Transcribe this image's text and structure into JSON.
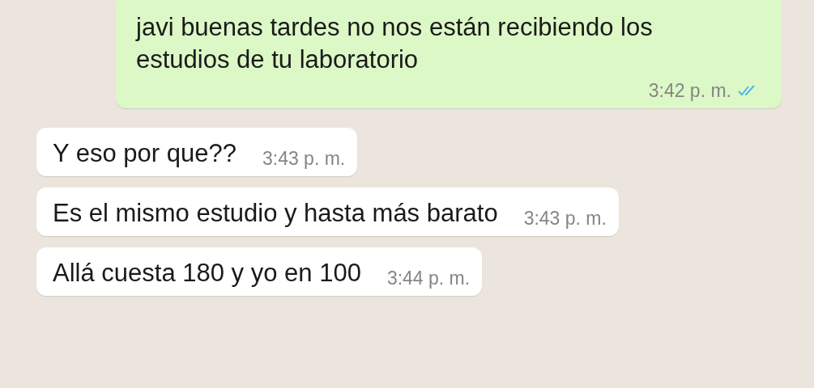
{
  "messages": [
    {
      "kind": "outgoing",
      "text": "javi buenas tardes no nos están recibiendo los estudios de tu laboratorio",
      "time": "3:42 p. m.",
      "read": true
    },
    {
      "kind": "incoming",
      "text": "Y eso por que??",
      "time": "3:43 p. m."
    },
    {
      "kind": "incoming",
      "text": "Es el mismo estudio y hasta más barato",
      "time": "3:43 p. m."
    },
    {
      "kind": "incoming",
      "text": "Allá cuesta 180 y yo en 100",
      "time": "3:44 p. m."
    }
  ]
}
